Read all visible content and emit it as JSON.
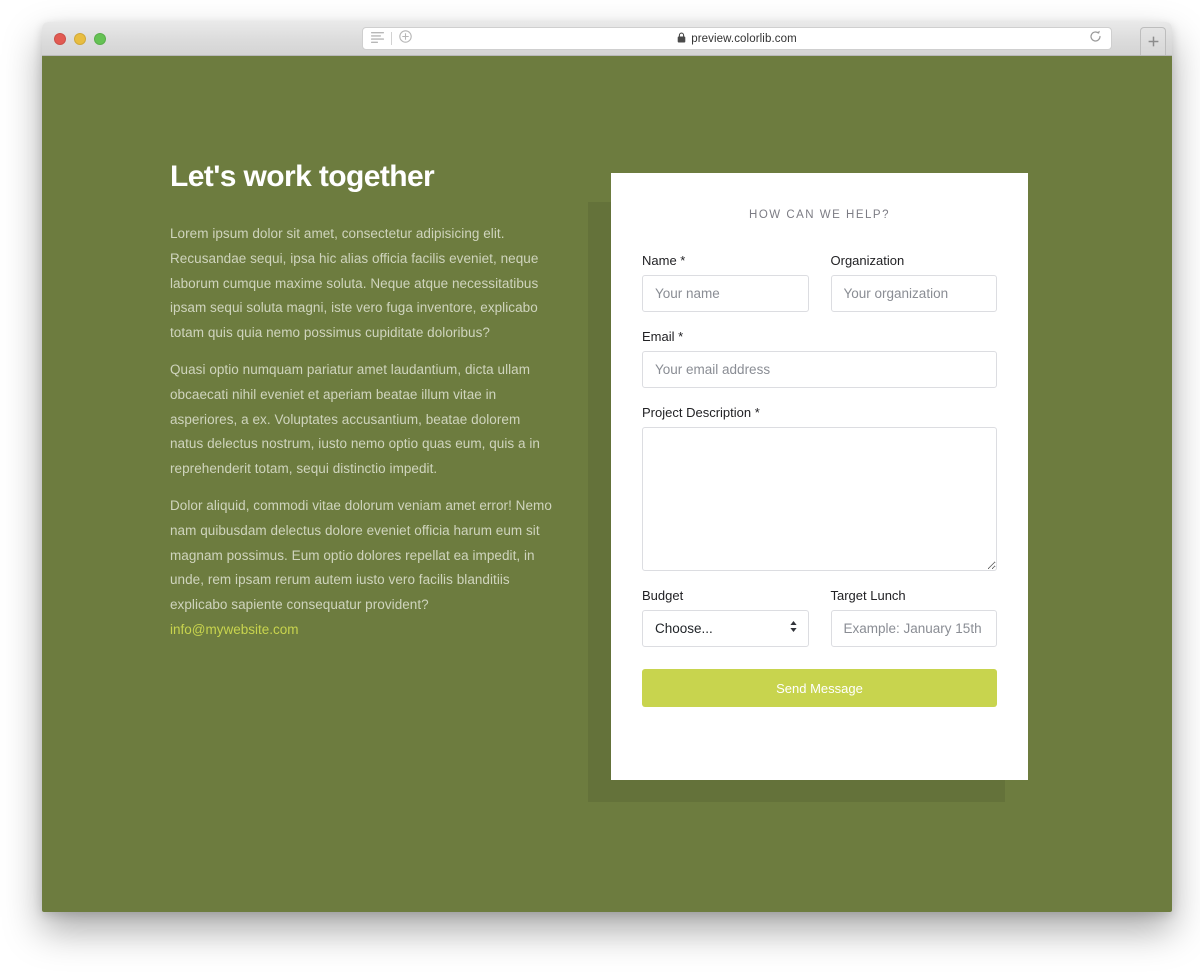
{
  "browser": {
    "url": "preview.colorlib.com",
    "lock_icon": "lock-icon",
    "reader_icon": "reader-view-icon",
    "add_icon": "plus-circle-icon",
    "reload_icon": "reload-icon",
    "newtab_icon": "plus-icon",
    "traffic_lights": [
      "close-red",
      "minimize-yellow",
      "maximize-green"
    ]
  },
  "hero": {
    "headline": "Let's work together",
    "paragraphs": [
      "Lorem ipsum dolor sit amet, consectetur adipisicing elit. Recusandae sequi, ipsa hic alias officia facilis eveniet, neque laborum cumque maxime soluta. Neque atque necessitatibus ipsam sequi soluta magni, iste vero fuga inventore, explicabo totam quis quia nemo possimus cupiditate doloribus?",
      "Quasi optio numquam pariatur amet laudantium, dicta ullam obcaecati nihil eveniet et aperiam beatae illum vitae in asperiores, a ex. Voluptates accusantium, beatae dolorem natus delectus nostrum, iusto nemo optio quas eum, quis a in reprehenderit totam, sequi distinctio impedit.",
      "Dolor aliquid, commodi vitae dolorum veniam amet error! Nemo nam quibusdam delectus dolore eveniet officia harum eum sit magnam possimus. Eum optio dolores repellat ea impedit, in unde, rem ipsam rerum autem iusto vero facilis blanditiis explicabo sapiente consequatur provident?"
    ],
    "email": "info@mywebsite.com"
  },
  "form": {
    "title": "HOW CAN WE HELP?",
    "fields": {
      "name": {
        "label": "Name *",
        "placeholder": "Your name",
        "value": ""
      },
      "organization": {
        "label": "Organization",
        "placeholder": "Your organization",
        "value": ""
      },
      "email": {
        "label": "Email *",
        "placeholder": "Your email address",
        "value": ""
      },
      "description": {
        "label": "Project Description *",
        "placeholder": "",
        "value": ""
      },
      "budget": {
        "label": "Budget",
        "selected": "Choose...",
        "options": [
          "Choose..."
        ]
      },
      "target_lunch": {
        "label": "Target Lunch",
        "placeholder": "Example: January 15th",
        "value": ""
      }
    },
    "submit_label": "Send Message"
  },
  "colors": {
    "page_background": "#6d7c3f",
    "card_shadow_block": "#64723a",
    "accent_button": "#c8d44e",
    "email_link": "#c8d44e",
    "body_text": "#cfd4bd"
  }
}
